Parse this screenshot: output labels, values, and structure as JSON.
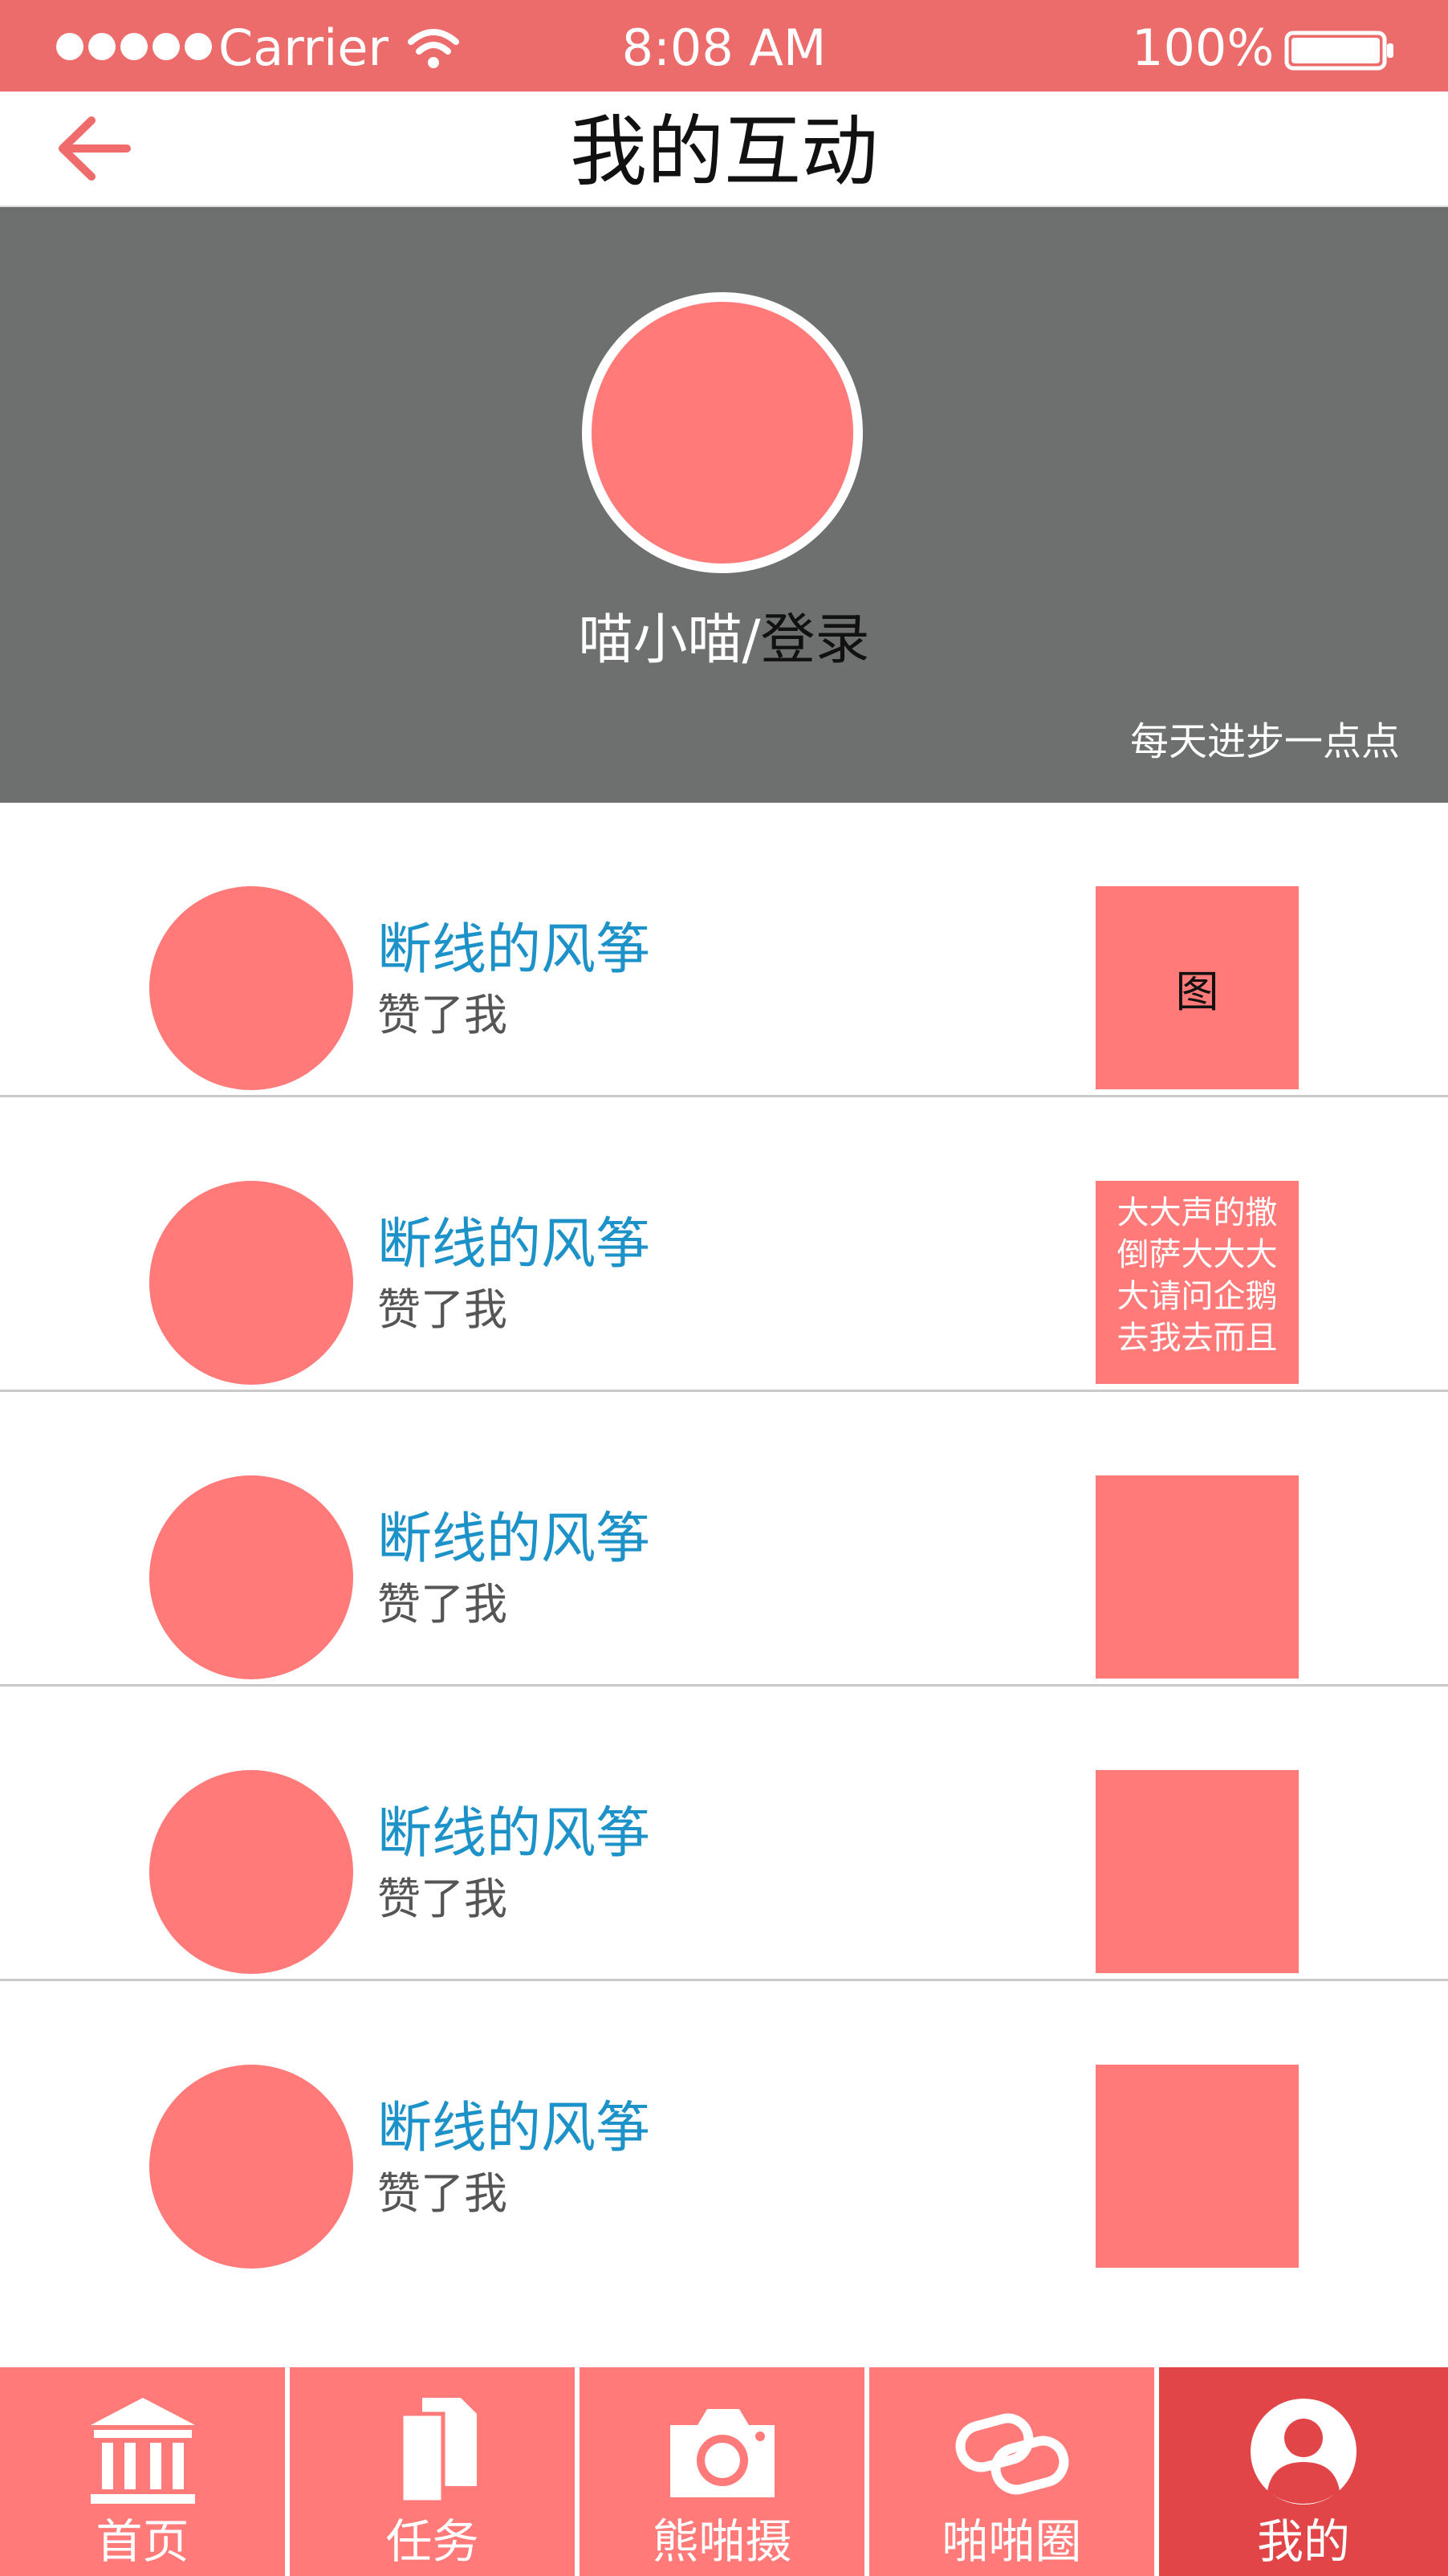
{
  "status_bar": {
    "carrier": "Carrier",
    "time": "8:08 AM",
    "battery": "100%",
    "icons": [
      "signal-dots-icon",
      "wifi-icon",
      "battery-icon"
    ]
  },
  "nav": {
    "back_icon": "arrow-left-icon",
    "title": "我的互动"
  },
  "profile": {
    "name": "喵小喵/",
    "login": "登录",
    "motto": "每天进步一点点"
  },
  "interactions": [
    {
      "name": "断线的风筝",
      "action": "赞了我",
      "thumb_text": "图",
      "thumb_style": "big"
    },
    {
      "name": "断线的风筝",
      "action": "赞了我",
      "thumb_text": "大大声的撒倒萨大大大大请问企鹅去我去而且",
      "thumb_style": "small"
    },
    {
      "name": "断线的风筝",
      "action": "赞了我",
      "thumb_text": "",
      "thumb_style": "none"
    },
    {
      "name": "断线的风筝",
      "action": "赞了我",
      "thumb_text": "",
      "thumb_style": "none"
    },
    {
      "name": "断线的风筝",
      "action": "赞了我",
      "thumb_text": "",
      "thumb_style": "none"
    }
  ],
  "tabs": [
    {
      "label": "首页",
      "icon": "bank-icon",
      "active": false
    },
    {
      "label": "任务",
      "icon": "documents-icon",
      "active": false
    },
    {
      "label": "熊啪摄",
      "icon": "camera-icon",
      "active": false
    },
    {
      "label": "啪啪圈",
      "icon": "link-icon",
      "active": false
    },
    {
      "label": "我的",
      "icon": "user-icon",
      "active": true
    }
  ],
  "colors": {
    "status_bar": "#ec6b6b",
    "accent": "#ff7a79",
    "active_tab": "#e14547",
    "header_bg": "#6e706f",
    "name_blue": "#1c92c9"
  }
}
